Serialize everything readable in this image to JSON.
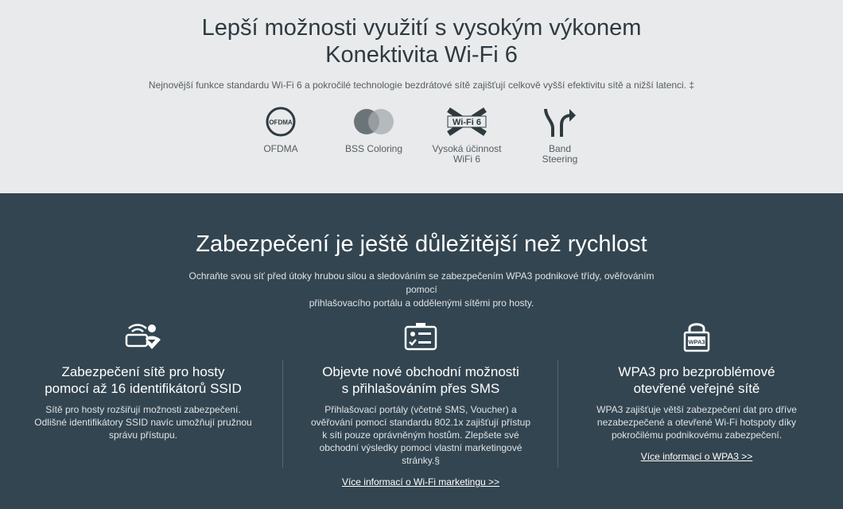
{
  "top": {
    "title_line1": "Lepší možnosti využití s vysokým výkonem",
    "title_line2": "Konektivita Wi-Fi 6",
    "subtitle": "Nejnovější funkce standardu Wi-Fi 6 a pokročilé technologie bezdrátové sítě zajišťují celkově vyšší efektivitu sítě a nižší latenci. ‡",
    "features": [
      {
        "icon": "ofdma-icon",
        "icon_text": "OFDMA",
        "label_line1": "OFDMA",
        "label_line2": ""
      },
      {
        "icon": "bss-coloring-icon",
        "label_line1": "BSS Coloring",
        "label_line2": ""
      },
      {
        "icon": "wifi6-icon",
        "icon_text": "Wi-Fi 6",
        "label_line1": "Vysoká účinnost",
        "label_line2": "WiFi 6"
      },
      {
        "icon": "band-steering-icon",
        "label_line1": "Band",
        "label_line2": "Steering"
      }
    ]
  },
  "bottom": {
    "title": "Zabezpečení je ještě důležitější než rychlost",
    "intro_line1": "Ochraňte svou síť před útoky hrubou silou a sledováním se zabezpečením WPA3 podnikové třídy, ověřováním pomocí",
    "intro_line2": "přihlašovacího portálu a oddělenými sítěmi pro hosty.",
    "columns": [
      {
        "icon": "guest-network-icon",
        "title_line1": "Zabezpečení sítě pro hosty",
        "title_line2": "pomocí až 16 identifikátorů SSID",
        "text_lines": [
          "Sítě pro hosty rozšiřují možnosti zabezpečení.",
          "Odlišné identifikátory SSID navíc umožňují pružnou",
          "správu přístupu."
        ],
        "link": ""
      },
      {
        "icon": "portal-login-icon",
        "title_line1": "Objevte nové obchodní možnosti",
        "title_line2": "s přihlašováním přes SMS",
        "text_lines": [
          "Přihlašovací portály (včetně SMS, Voucher) a",
          "ověřování pomocí standardu 802.1x zajišťují přístup",
          "k síti pouze oprávněným hostům. Zlepšete své",
          "obchodní výsledky pomocí vlastní marketingové",
          "stránky.§"
        ],
        "link": "Více informací o Wi-Fi marketingu >>"
      },
      {
        "icon": "wpa3-lock-icon",
        "icon_text": "WPA3",
        "title_line1": "WPA3 pro bezproblémové",
        "title_line2": "otevřené veřejné sítě",
        "text_lines": [
          "WPA3 zajišťuje větší zabezpečení dat pro dříve",
          "nezabezpečené a otevřené Wi-Fi hotspoty díky",
          "pokročilému podnikovému zabezpečení."
        ],
        "link": "Více informací o WPA3 >>"
      }
    ]
  },
  "colors": {
    "top_bg": "#e8eaeb",
    "bottom_bg": "#334550",
    "icon_dark": "#2f3a40"
  }
}
